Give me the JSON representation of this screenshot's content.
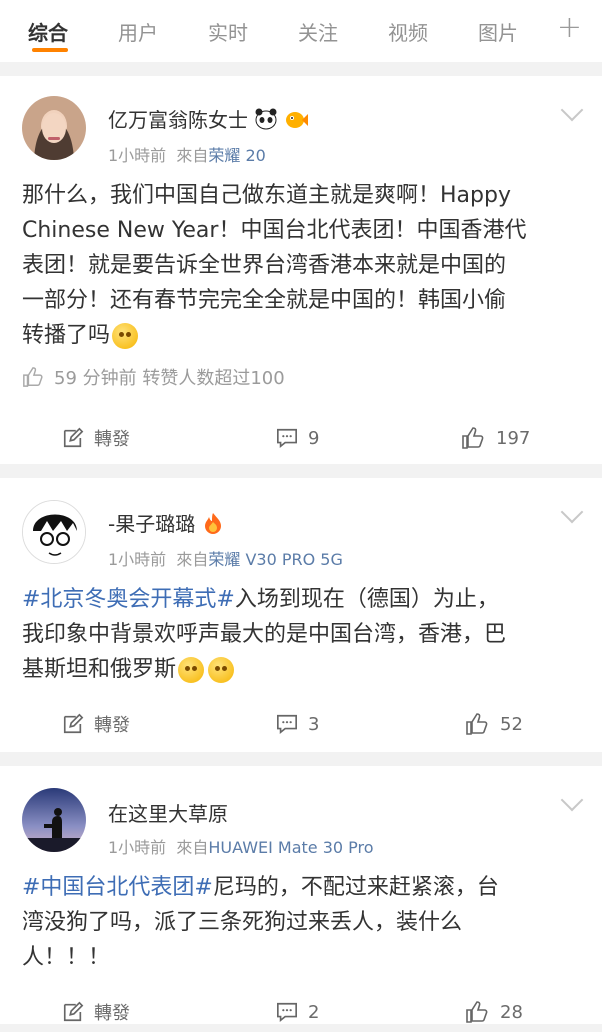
{
  "tabs": [
    "综合",
    "用户",
    "实时",
    "关注",
    "视频",
    "图片"
  ],
  "add_tab": "+",
  "posts": [
    {
      "user": "亿万富翁陈女士",
      "time": "1小時前",
      "from_label": "來自",
      "device": "荣耀 20",
      "body_lines": [
        "那什么，我们中国自己做东道主就是爽啊！Happy",
        "Chinese New Year！中国台北代表团！中国香港代",
        "表团！就是要告诉全世界台湾香港本来就是中国的",
        "一部分！还有春节完完全全就是中国的！韩国小偷",
        "转播了吗"
      ],
      "like_note": "59 分钟前  转赞人数超过100",
      "repost": "轉發",
      "comments": "9",
      "likes": "197"
    },
    {
      "user": "-果子璐璐",
      "time": "1小時前",
      "from_label": "來自",
      "device": "荣耀 V30 PRO 5G",
      "tag": "#北京冬奥会开幕式#",
      "body_lines": [
        "入场到现在（德国）为止，",
        "我印象中背景欢呼声最大的是中国台湾，香港，巴",
        "基斯坦和俄罗斯"
      ],
      "repost": "轉發",
      "comments": "3",
      "likes": "52"
    },
    {
      "user": "在这里大草原",
      "time": "1小時前",
      "from_label": "來自",
      "device": "HUAWEI Mate 30 Pro",
      "tag": "#中国台北代表团#",
      "body_lines": [
        "尼玛的，不配过来赶紧滚，台",
        "湾没狗了吗，派了三条死狗过来丢人，装什么",
        "人！！！"
      ],
      "repost": "轉發",
      "comments": "2",
      "likes": "28"
    }
  ]
}
